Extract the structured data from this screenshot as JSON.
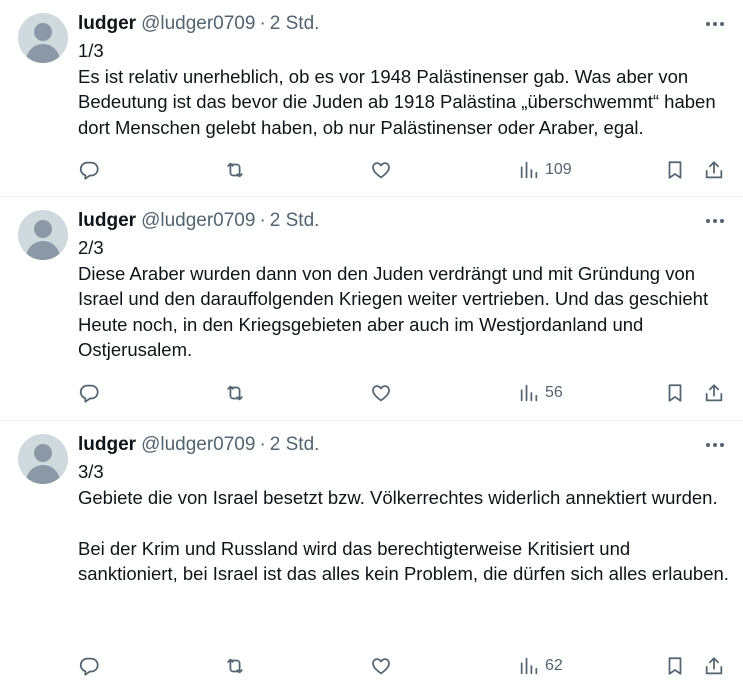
{
  "tweets": [
    {
      "name": "ludger",
      "handle": "@ludger0709",
      "separator": "·",
      "time": "2 Std.",
      "text": "1/3\nEs ist relativ unerheblich, ob es vor 1948 Palästinenser gab. Was aber von Bedeutung ist das bevor die Juden ab 1918 Palästina „überschwemmt“ haben dort Menschen gelebt haben, ob nur Palästinenser oder Araber, egal.",
      "views": "109"
    },
    {
      "name": "ludger",
      "handle": "@ludger0709",
      "separator": "·",
      "time": "2 Std.",
      "text": "2/3\nDiese Araber wurden dann von den Juden verdrängt und mit Gründung von Israel und den darauffolgenden Kriegen weiter vertrieben. Und das geschieht Heute noch, in den Kriegsgebieten aber auch im Westjordanland und Ostjerusalem.",
      "views": "56"
    },
    {
      "name": "ludger",
      "handle": "@ludger0709",
      "separator": "·",
      "time": "2 Std.",
      "text": "3/3\nGebiete die von Israel besetzt bzw. Völkerrechtes widerlich annektiert wurden.\n\nBei der Krim und Russland wird das berechtigterweise Kritisiert und sanktioniert, bei Israel ist das alles kein Problem, die dürfen sich alles erlauben.",
      "views": "62"
    }
  ],
  "icons": {
    "reply": "reply-icon",
    "retweet": "retweet-icon",
    "like": "heart-icon",
    "views": "views-icon",
    "bookmark": "bookmark-icon",
    "share": "share-icon",
    "more": "more-icon"
  },
  "colors": {
    "text": "#0f1419",
    "secondary": "#536471",
    "divider": "#eff3f4",
    "avatar_bg": "#cfd9de"
  }
}
